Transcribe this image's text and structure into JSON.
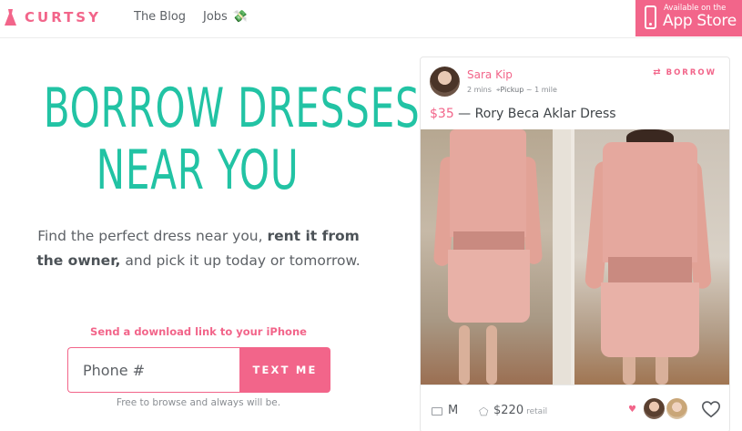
{
  "nav": {
    "logo_text": "CURTSY",
    "blog_label": "The Blog",
    "jobs_label": "Jobs",
    "jobs_icon": "money-icon",
    "appstore": {
      "small": "Available on the",
      "big": "App Store"
    }
  },
  "hero": {
    "title_line1": "BORROW DRESSES",
    "title_line2": "NEAR YOU",
    "desc_part1": "Find the perfect dress near you, ",
    "desc_bold": "rent it from the owner,",
    "desc_part2": " and pick it up today or tomorrow.",
    "send_label": "Send a download link to your iPhone",
    "input_placeholder": "Phone #",
    "button_label": "TEXT ME",
    "free_note": "Free to browse and always will be."
  },
  "listing": {
    "seller_name": "Sara Kip",
    "time_ago": "2 mins",
    "pickup_label": "Pickup",
    "distance": "~ 1 mile",
    "borrow_tag": "BORROW",
    "price": "$35",
    "separator": " — ",
    "item_name": "Rory Beca Aklar Dress",
    "size": "M",
    "retail_price": "$220",
    "retail_word": "retail"
  },
  "colors": {
    "brand_pink": "#f2658a",
    "hero_teal": "#22c3a4",
    "text_gray": "#5d6166"
  }
}
